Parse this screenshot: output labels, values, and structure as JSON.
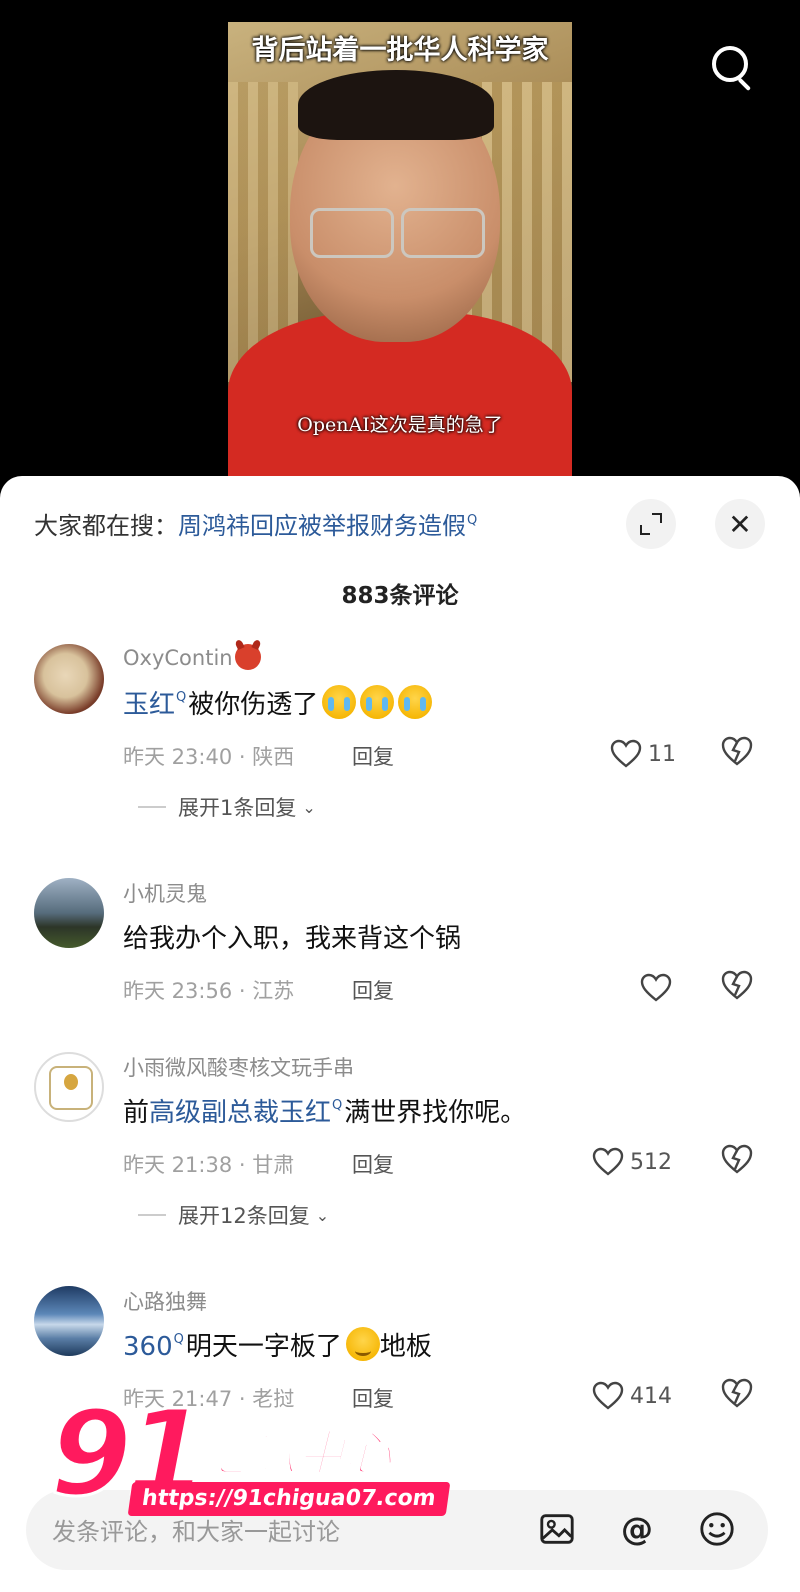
{
  "video": {
    "headline": "背后站着一批华人科学家",
    "caption": "OpenAI这次是真的急了"
  },
  "search_hint": {
    "prefix": "大家都在搜：",
    "query": "周鸿祎回应被举报财务造假"
  },
  "comment_count": "883条评论",
  "comments": [
    {
      "user": "OxyContin",
      "text_link": "玉红",
      "text": "被你伤透了",
      "time_location": "昨天 23:40 · 陕西",
      "reply": "回复",
      "likes": "11",
      "expand": "展开1条回复"
    },
    {
      "user": "小机灵鬼",
      "text": "给我办个入职，我来背这个锅",
      "time_location": "昨天 23:56 · 江苏",
      "reply": "回复",
      "likes": ""
    },
    {
      "user": "小雨微风酸枣核文玩手串",
      "text_prefix": "前",
      "text_link": "高级副总裁玉红",
      "text": "满世界找你呢。",
      "time_location": "昨天 21:38 · 甘肃",
      "reply": "回复",
      "likes": "512",
      "expand": "展开12条回复"
    },
    {
      "user": "心路独舞",
      "text_link": "360",
      "text": "明天一字板了",
      "text_suffix": "地板",
      "time_location": "昨天 21:47 · 老挝",
      "reply": "回复",
      "likes": "414"
    }
  ],
  "input": {
    "placeholder": "发条评论，和大家一起讨论"
  },
  "watermark": {
    "number": "91",
    "name": "吃瓜中心",
    "url": "https://91chigua07.com"
  },
  "colors": {
    "link": "#2c5a99",
    "sheet": "#ffffff",
    "watermark": "#ff1a5e"
  },
  "icons": [
    "search-icon",
    "expand-icon",
    "close-icon",
    "heart-icon",
    "dislike-icon",
    "image-icon",
    "at-icon",
    "emoji-icon"
  ]
}
